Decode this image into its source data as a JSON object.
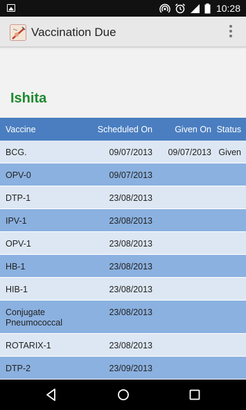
{
  "status_bar": {
    "time": "10:28"
  },
  "app": {
    "title": "Vaccination Due"
  },
  "child": {
    "name": "Ishita"
  },
  "table": {
    "headers": {
      "vaccine": "Vaccine",
      "scheduled": "Scheduled On",
      "given": "Given On",
      "status": "Status"
    },
    "rows": [
      {
        "vaccine": "BCG.",
        "scheduled": "09/07/2013",
        "given": "09/07/2013",
        "status": "Given"
      },
      {
        "vaccine": "OPV-0",
        "scheduled": "09/07/2013",
        "given": "",
        "status": ""
      },
      {
        "vaccine": "DTP-1",
        "scheduled": "23/08/2013",
        "given": "",
        "status": ""
      },
      {
        "vaccine": "IPV-1",
        "scheduled": "23/08/2013",
        "given": "",
        "status": ""
      },
      {
        "vaccine": "OPV-1",
        "scheduled": "23/08/2013",
        "given": "",
        "status": ""
      },
      {
        "vaccine": "HB-1",
        "scheduled": "23/08/2013",
        "given": "",
        "status": ""
      },
      {
        "vaccine": "HIB-1",
        "scheduled": "23/08/2013",
        "given": "",
        "status": ""
      },
      {
        "vaccine": "Conjugate Pneumococcal",
        "scheduled": "23/08/2013",
        "given": "",
        "status": ""
      },
      {
        "vaccine": "ROTARIX-1",
        "scheduled": "23/08/2013",
        "given": "",
        "status": ""
      },
      {
        "vaccine": "DTP-2",
        "scheduled": "23/09/2013",
        "given": "",
        "status": ""
      }
    ]
  },
  "colors": {
    "header": "#4a7ec0",
    "row_light": "#dde7f3",
    "row_dark": "#8bb1e0",
    "name": "#1f8a2e"
  }
}
